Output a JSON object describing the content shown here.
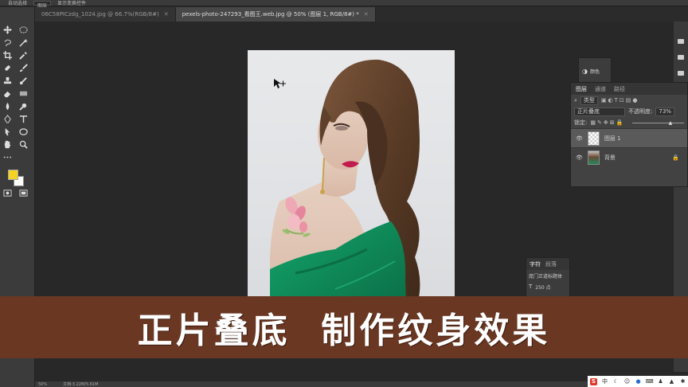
{
  "app": {
    "options_bar": {
      "items": [
        "自动选择",
        "图层",
        "显示变换控件"
      ]
    },
    "tabs": [
      {
        "label": "06C58PICzdg_1024.jpg @ 66.7%(RGB/8#)",
        "active": false
      },
      {
        "label": "pexels-photo-247293_看图王.web.jpg @ 50% (图层 1, RGB/8#) *",
        "active": true
      }
    ]
  },
  "toolbar": {
    "tools": [
      "move-icon",
      "marquee-icon",
      "lasso-icon",
      "magic-wand-icon",
      "crop-icon",
      "eyedropper-icon",
      "healing-icon",
      "brush-icon",
      "stamp-icon",
      "history-brush-icon",
      "eraser-icon",
      "gradient-icon",
      "blur-icon",
      "dodge-icon",
      "pen-icon",
      "type-icon",
      "path-select-icon",
      "shape-icon",
      "hand-icon",
      "zoom-icon",
      "more-icon"
    ],
    "foreground_color": "#f5d322",
    "background_color": "#ffffff"
  },
  "mini_panel": {
    "label": "颜色"
  },
  "layers_panel": {
    "tabs": [
      "图层",
      "通道",
      "路径"
    ],
    "filter_label": "类型",
    "blend_mode": "正片叠底",
    "opacity_label": "不透明度:",
    "opacity_value": "73%",
    "lock_label": "锁定:",
    "layers": [
      {
        "name": "图层 1",
        "selected": true,
        "locked": false
      },
      {
        "name": "背景",
        "selected": false,
        "locked": true
      }
    ]
  },
  "char_panel": {
    "tabs": [
      "字符",
      "段落"
    ],
    "font": "庞门正道标题体",
    "size": "250 点"
  },
  "status_bar": {
    "zoom": "50%",
    "doc_info": "文档:3.22M/5.61M"
  },
  "subtitle": {
    "text": "正片叠底  制作纹身效果"
  },
  "ime": {
    "logo": "S",
    "lang": "中"
  }
}
